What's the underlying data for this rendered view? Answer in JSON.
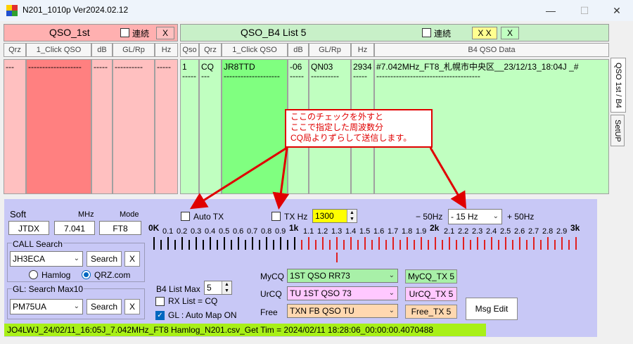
{
  "window": {
    "title": "N201_1010p  Ver2024.02.12",
    "minimize": "—",
    "maximize": "☐",
    "close": "✕"
  },
  "qso1": {
    "title": "QSO_1st",
    "renzoku": "連続",
    "x": "X",
    "cols": [
      "Qrz",
      "1_Click QSO",
      "dB",
      "GL/Rp",
      "Hz"
    ],
    "row1": [
      "---",
      "-------------------",
      "-----",
      "----------",
      "-----"
    ]
  },
  "b4": {
    "title": "QSO_B4   List  5",
    "renzoku": "連続",
    "xx": "X X",
    "x": "X",
    "cols": [
      "Qso",
      "Qrz",
      "1_Click QSO",
      "dB",
      "GL/Rp",
      "Hz",
      "B4 QSO Data"
    ],
    "row1": [
      "1",
      "CQ",
      "JR8TTD",
      "-06",
      "QN03",
      "2934",
      "#7.042MHz_FT8_札幌市中央区__23/12/13_18:04J    _#"
    ],
    "row2": [
      "-----",
      "---",
      "--------------------",
      "-----",
      "----------",
      "-----",
      "-------------------------------------"
    ]
  },
  "tabs": {
    "tab1": "QSO 1st / B4",
    "tab2": "SetUP"
  },
  "callout": {
    "line1": "ここのチェックを外すと",
    "line2": "ここで指定した周波数分",
    "line3": "CQ局よりずらして送信します。"
  },
  "soft": {
    "label": "Soft",
    "mhz_label": "MHz",
    "mode_label": "Mode",
    "soft": "JTDX",
    "mhz": "7.041",
    "mode": "FT8"
  },
  "call": {
    "label": "CALL Search",
    "value": "JH3ECA",
    "search": "Search",
    "x": "X",
    "hamlog": "Hamlog",
    "qrz": "QRZ.com"
  },
  "gl": {
    "label": "GL:  Search Max10",
    "value": "PM75UA",
    "search": "Search",
    "x": "X"
  },
  "auto": {
    "autotx": "Auto TX",
    "txhz": "TX Hz",
    "txhz_value": "1300",
    "minus": "− 50Hz",
    "offset": "- 15 Hz",
    "plus": "+ 50Hz"
  },
  "scale": {
    "labels": [
      "0K",
      "0.1",
      "0.2",
      "0.3",
      "0.4",
      "0.5",
      "0.6",
      "0.7",
      "0.8",
      "0.9",
      "1k",
      "1.1",
      "1.2",
      "1.3",
      "1.4",
      "1.5",
      "1.6",
      "1.7",
      "1.8",
      "1.9",
      "2k",
      "2.1",
      "2.2",
      "2.3",
      "2.4",
      "2.5",
      "2.6",
      "2.7",
      "2.8",
      "2.9",
      "3k"
    ],
    "marker_hz": 1300
  },
  "b4opt": {
    "listmax_label": "B4 List Max",
    "listmax": "5",
    "rxlist": "RX List = CQ",
    "glauto": "GL : Auto Map ON"
  },
  "msgs": {
    "mycq_label": "MyCQ",
    "mycq": "1ST QSO RR73",
    "urcq_label": "UrCQ",
    "urcq": "TU 1ST QSO 73",
    "free_label": "Free",
    "free": "TXN FB QSO TU",
    "mycq_tx": "MyCQ_TX 5",
    "urcq_tx": "UrCQ_TX 5",
    "free_tx": "Free_TX 5",
    "msgedit": "Msg Edit"
  },
  "status": "JO4LWJ_24/02/11_16:05J_7.042MHz_FT8        Hamlog_N201.csv_Get Tim = 2024/02/11 18:28:06_00:00:00.4070488",
  "colors": {
    "qso1": "#ffc0c0",
    "qso1_hdr": "#ffb0b0",
    "b4": "#c0ffc0",
    "b4_hdr": "#c8f0c8",
    "click_pink": "#ff8080",
    "click_green": "#80ff80",
    "panel": "#c8c8f6",
    "mycq": "#a8f0a8",
    "urcq": "#ffc8ff",
    "free": "#ffd8b0",
    "status": "#a8f018",
    "txhz": "#ffff00",
    "callout": "#e00000"
  }
}
